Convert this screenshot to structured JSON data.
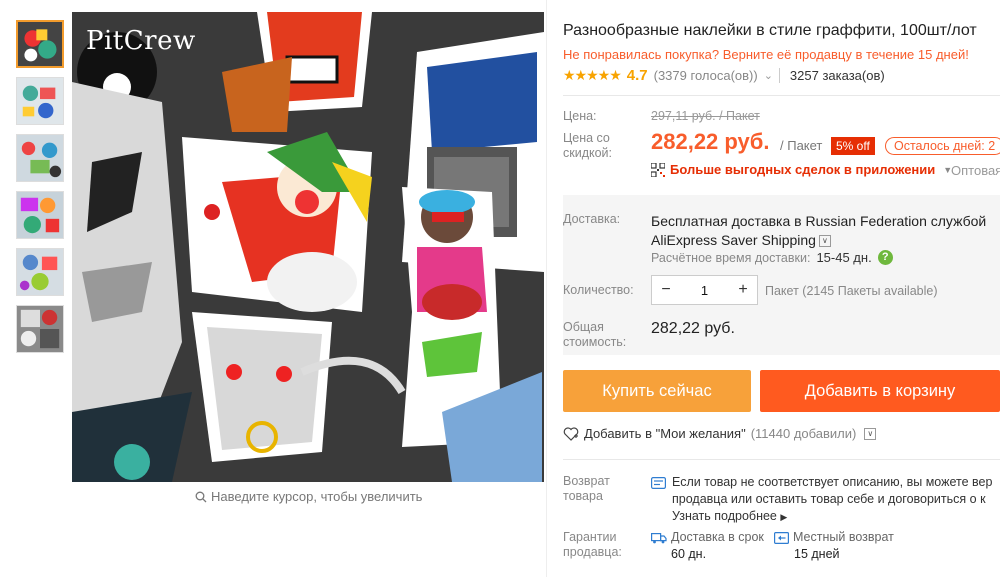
{
  "brand_logo": "PitCrew",
  "zoom_hint": "Наведите курсор, чтобы увеличить",
  "product": {
    "title": "Разнообразные наклейки в стиле граффити, 100шт/лот",
    "promo": "Не понравилась покупка? Верните её продавцу в течение 15 дней!",
    "rating": "4.7",
    "votes": "(3379 голоса(ов))",
    "orders": "3257 заказа(ов)"
  },
  "price": {
    "label": "Цена:",
    "old": "297,11 руб. / Пакет",
    "discount_label": "Цена со скидкой:",
    "new": "282,22 руб.",
    "unit": "/ Пакет",
    "off_badge": "5% off",
    "left_badge": "Осталось дней: 2",
    "app_deals": "Больше выгодных сделок в приложении",
    "wholesale": "Оптовая"
  },
  "shipping": {
    "label": "Доставка:",
    "text": "Бесплатная доставка в Russian Federation службой AliExpress Saver Shipping",
    "eta_label": "Расчётное время доставки:",
    "eta_value": "15-45 дн."
  },
  "quantity": {
    "label": "Количество:",
    "value": "1",
    "minus": "−",
    "plus": "+",
    "available": "Пакет (2145 Пакеты available)"
  },
  "total": {
    "label": "Общая стоимость:",
    "value": "282,22 руб."
  },
  "buttons": {
    "buy": "Купить сейчас",
    "cart": "Добавить в корзину"
  },
  "wishlist": {
    "label": "Добавить в \"Мои желания\"",
    "count": "(11440 добавили)"
  },
  "returns": {
    "label": "Возврат товара",
    "line1": "Если товар не соответствует описанию, вы можете вер",
    "line2": "продавца или оставить товар себе и договориться о к",
    "learn_more": "Узнать подробнее"
  },
  "guarantees": {
    "label": "Гарантии продавца:",
    "delivery_title": "Доставка в срок",
    "delivery_value": "60 дн.",
    "return_title": "Местный возврат",
    "return_value": "15 дней"
  },
  "colors": {
    "accent": "#f85d2c",
    "buy": "#f7a13a",
    "cart": "#ff5a1f",
    "badge": "#e62e04",
    "star": "#f8a300"
  }
}
